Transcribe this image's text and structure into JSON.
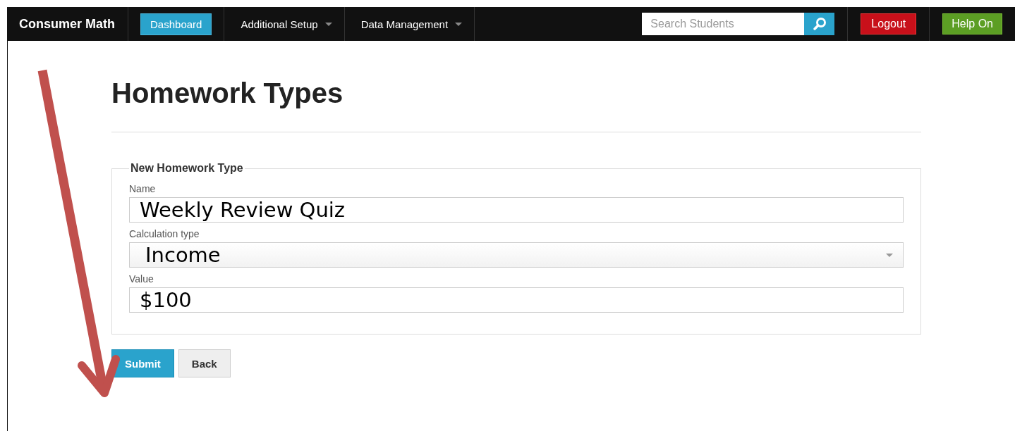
{
  "navbar": {
    "brand": "Consumer Math",
    "items": [
      {
        "label": "Dashboard",
        "kind": "button",
        "selected": true
      },
      {
        "label": "Additional Setup",
        "kind": "dropdown",
        "selected": false
      },
      {
        "label": "Data Management",
        "kind": "dropdown",
        "selected": false
      }
    ],
    "search": {
      "placeholder": "Search Students"
    },
    "logout": "Logout",
    "help": "Help On"
  },
  "page": {
    "title": "Homework Types",
    "form": {
      "legend": "New Homework Type",
      "fields": [
        {
          "label": "Name",
          "kind": "text",
          "value": "Weekly Review Quiz"
        },
        {
          "label": "Calculation type",
          "kind": "select",
          "value": "Income"
        },
        {
          "label": "Value",
          "kind": "text",
          "value": "$100"
        }
      ]
    },
    "buttons": [
      {
        "label": "Submit",
        "kind": "primary"
      },
      {
        "label": "Back",
        "kind": "default"
      }
    ]
  }
}
